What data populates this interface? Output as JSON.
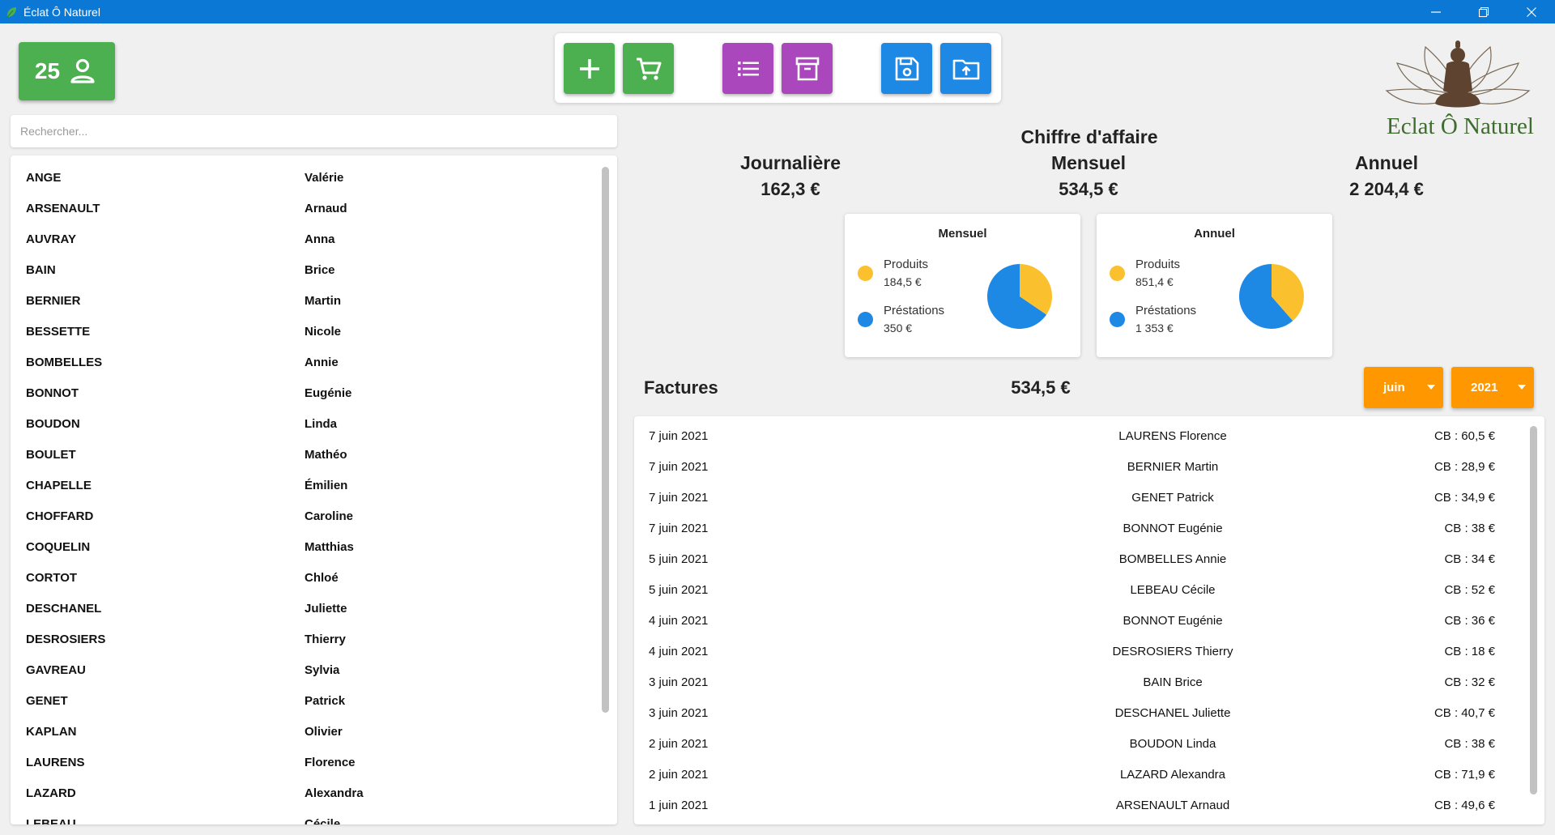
{
  "app": {
    "title": "Éclat Ô Naturel"
  },
  "client_count": "25",
  "search": {
    "placeholder": "Rechercher..."
  },
  "clients": [
    {
      "last": "ANGE",
      "first": "Valérie"
    },
    {
      "last": "ARSENAULT",
      "first": "Arnaud"
    },
    {
      "last": "AUVRAY",
      "first": "Anna"
    },
    {
      "last": "BAIN",
      "first": "Brice"
    },
    {
      "last": "BERNIER",
      "first": "Martin"
    },
    {
      "last": "BESSETTE",
      "first": "Nicole"
    },
    {
      "last": "BOMBELLES",
      "first": "Annie"
    },
    {
      "last": "BONNOT",
      "first": "Eugénie"
    },
    {
      "last": "BOUDON",
      "first": "Linda"
    },
    {
      "last": "BOULET",
      "first": "Mathéo"
    },
    {
      "last": "CHAPELLE",
      "first": "Émilien"
    },
    {
      "last": "CHOFFARD",
      "first": "Caroline"
    },
    {
      "last": "COQUELIN",
      "first": "Matthias"
    },
    {
      "last": "CORTOT",
      "first": "Chloé"
    },
    {
      "last": "DESCHANEL",
      "first": "Juliette"
    },
    {
      "last": "DESROSIERS",
      "first": "Thierry"
    },
    {
      "last": "GAVREAU",
      "first": "Sylvia"
    },
    {
      "last": "GENET",
      "first": "Patrick"
    },
    {
      "last": "KAPLAN",
      "first": "Olivier"
    },
    {
      "last": "LAURENS",
      "first": "Florence"
    },
    {
      "last": "LAZARD",
      "first": "Alexandra"
    },
    {
      "last": "LEBEAU",
      "first": "Cécile"
    }
  ],
  "logo": {
    "text": "Eclat Ô Naturel"
  },
  "revenue": {
    "title": "Chiffre d'affaire",
    "daily_label": "Journalière",
    "daily_value": "162,3 €",
    "monthly_label": "Mensuel",
    "monthly_value": "534,5 €",
    "annual_label": "Annuel",
    "annual_value": "2 204,4 €"
  },
  "cards": {
    "monthly": {
      "title": "Mensuel",
      "products_label": "Produits",
      "products_value": "184,5 €",
      "services_label": "Préstations",
      "services_value": "350 €",
      "products_share": 0.345
    },
    "annual": {
      "title": "Annuel",
      "products_label": "Produits",
      "products_value": "851,4 €",
      "services_label": "Préstations",
      "services_value": "1 353 €",
      "products_share": 0.386
    }
  },
  "colors": {
    "products": "#fbc02d",
    "services": "#1e88e5",
    "green": "#4caf50",
    "purple": "#ab47bc",
    "blue": "#1e88e5",
    "orange": "#ff9800",
    "titlebar": "#0a78d4"
  },
  "toolbar": {
    "icons": [
      "plus-icon",
      "cart-icon",
      "list-icon",
      "archive-icon",
      "save-icon",
      "folder-upload-icon"
    ]
  },
  "factures": {
    "title": "Factures",
    "total": "534,5 €",
    "month": "juin",
    "year": "2021",
    "rows": [
      {
        "date": "7 juin 2021",
        "name": "LAURENS Florence",
        "payment": "CB : 60,5 €"
      },
      {
        "date": "7 juin 2021",
        "name": "BERNIER Martin",
        "payment": "CB : 28,9 €"
      },
      {
        "date": "7 juin 2021",
        "name": "GENET Patrick",
        "payment": "CB : 34,9 €"
      },
      {
        "date": "7 juin 2021",
        "name": "BONNOT Eugénie",
        "payment": "CB : 38 €"
      },
      {
        "date": "5 juin 2021",
        "name": "BOMBELLES Annie",
        "payment": "CB : 34 €"
      },
      {
        "date": "5 juin 2021",
        "name": "LEBEAU Cécile",
        "payment": "CB : 52 €"
      },
      {
        "date": "4 juin 2021",
        "name": "BONNOT Eugénie",
        "payment": "CB : 36 €"
      },
      {
        "date": "4 juin 2021",
        "name": "DESROSIERS Thierry",
        "payment": "CB : 18 €"
      },
      {
        "date": "3 juin 2021",
        "name": "BAIN Brice",
        "payment": "CB : 32 €"
      },
      {
        "date": "3 juin 2021",
        "name": "DESCHANEL Juliette",
        "payment": "CB : 40,7 €"
      },
      {
        "date": "2 juin 2021",
        "name": "BOUDON Linda",
        "payment": "CB : 38 €"
      },
      {
        "date": "2 juin 2021",
        "name": "LAZARD Alexandra",
        "payment": "CB : 71,9 €"
      },
      {
        "date": "1 juin 2021",
        "name": "ARSENAULT Arnaud",
        "payment": "CB : 49,6 €"
      }
    ]
  }
}
